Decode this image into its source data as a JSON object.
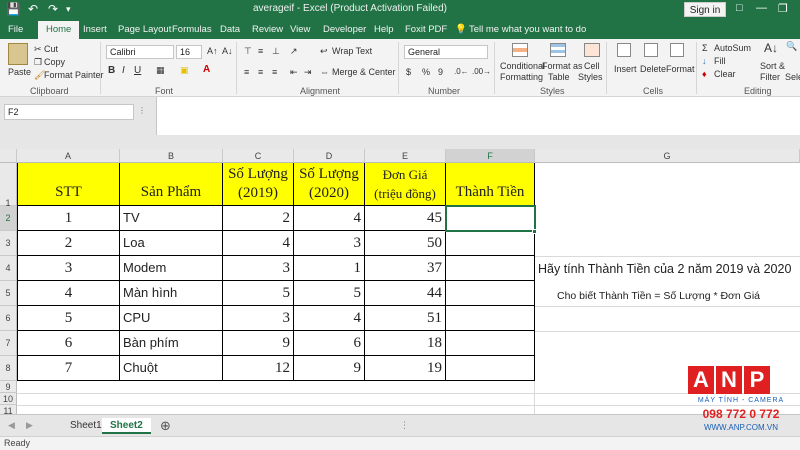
{
  "window": {
    "title": "averageif  -  Excel (Product Activation Failed)",
    "sign_in": "Sign in"
  },
  "tabs": [
    "File",
    "Home",
    "Insert",
    "Page Layout",
    "Formulas",
    "Data",
    "Review",
    "View",
    "Developer",
    "Help",
    "Foxit PDF"
  ],
  "tell_me": "Tell me what you want to do",
  "ribbon": {
    "clipboard": {
      "label": "Clipboard",
      "paste": "Paste",
      "cut": "Cut",
      "copy": "Copy",
      "format_painter": "Format Painter"
    },
    "font": {
      "label": "Font",
      "name": "Calibri",
      "size": "16",
      "bold": "B",
      "italic": "I",
      "underline": "U"
    },
    "alignment": {
      "label": "Alignment",
      "wrap": "Wrap Text",
      "merge": "Merge & Center"
    },
    "number": {
      "label": "Number",
      "format": "General",
      "currency": "$",
      "percent": "%",
      "comma": "9"
    },
    "styles": {
      "label": "Styles",
      "conditional": "Conditional",
      "conditional2": "Formatting",
      "format_as": "Format as",
      "table": "Table",
      "cell": "Cell",
      "styles": "Styles"
    },
    "cells": {
      "label": "Cells",
      "insert": "Insert",
      "delete": "Delete",
      "format": "Format"
    },
    "editing": {
      "label": "Editing",
      "autosum": "AutoSum",
      "fill": "Fill",
      "clear": "Clear",
      "sort": "Sort &",
      "filter": "Filter",
      "select": "Selec"
    }
  },
  "formula_bar": {
    "name_box": "F2",
    "fx": "fx",
    "value": ""
  },
  "grid": {
    "columns": [
      "A",
      "B",
      "C",
      "D",
      "E",
      "F",
      "G"
    ],
    "rows": [
      "1",
      "2",
      "3",
      "4",
      "5",
      "6",
      "7",
      "8",
      "9",
      "10",
      "11"
    ],
    "headers": {
      "A": "STT",
      "B": "Sản Phẩm",
      "C1": "Số Lượng",
      "C2": "(2019)",
      "D1": "Số Lượng",
      "D2": "(2020)",
      "E1": "Đơn Giá",
      "E2": "(triệu đồng)",
      "F": "Thành Tiền"
    },
    "data": [
      {
        "stt": "1",
        "product": "TV",
        "qty2019": "2",
        "qty2020": "4",
        "price": "45"
      },
      {
        "stt": "2",
        "product": "Loa",
        "qty2019": "4",
        "qty2020": "3",
        "price": "50"
      },
      {
        "stt": "3",
        "product": "Modem",
        "qty2019": "3",
        "qty2020": "1",
        "price": "37"
      },
      {
        "stt": "4",
        "product": "Màn hình",
        "qty2019": "5",
        "qty2020": "5",
        "price": "44"
      },
      {
        "stt": "5",
        "product": "CPU",
        "qty2019": "3",
        "qty2020": "4",
        "price": "51"
      },
      {
        "stt": "6",
        "product": "Bàn phím",
        "qty2019": "9",
        "qty2020": "6",
        "price": "18"
      },
      {
        "stt": "7",
        "product": "Chuột",
        "qty2019": "12",
        "qty2020": "9",
        "price": "19"
      }
    ],
    "note1": "Hãy tính Thành Tiền của 2 năm 2019 và 2020",
    "note2": "Cho biết Thành Tiền = Số Lượng * Đơn Giá"
  },
  "sheets": [
    "Sheet1",
    "Sheet2"
  ],
  "active_sheet": "Sheet2",
  "status": "Ready",
  "watermark": {
    "letters": "ANP",
    "line1": "MÁY TÍNH - CAMERA",
    "phone": "098 772 0 772",
    "site": "WWW.ANP.COM.VN"
  },
  "colors": {
    "excel_green": "#217346",
    "header_yellow": "#ffff00",
    "anp_red": "#e02020",
    "anp_blue": "#1a5fb4"
  }
}
